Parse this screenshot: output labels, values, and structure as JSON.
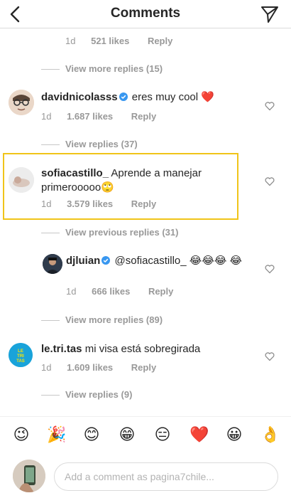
{
  "header": {
    "title": "Comments",
    "back_icon": "chevron-left-icon",
    "send_icon": "paper-plane-icon"
  },
  "top_reply_meta": {
    "time": "1d",
    "likes": "521 likes",
    "reply": "Reply"
  },
  "view_more_1": "View more replies (15)",
  "comments": [
    {
      "username": "davidnicolasss",
      "verified": true,
      "text": "eres muy cool ❤️",
      "time": "1d",
      "likes": "1.687 likes",
      "reply": "Reply",
      "view_replies": "View replies (37)"
    },
    {
      "username": "sofiacastillo_",
      "verified": false,
      "text": "Aprende a manejar primerooooo🙄",
      "time": "1d",
      "likes": "3.579 likes",
      "reply": "Reply",
      "view_previous": "View previous replies (31)"
    }
  ],
  "reply_djluian": {
    "username": "djluian",
    "verified": true,
    "text": "@sofiacastillo_ 😂😂😂 😂",
    "time": "1d",
    "likes": "666 likes",
    "reply": "Reply",
    "view_more": "View more replies (89)"
  },
  "comment_letritas": {
    "username": "le.tri.tas",
    "avatar_text": "LE TRI TAS",
    "text": "mi visa está sobregirada",
    "time": "1d",
    "likes": "1.609 likes",
    "reply": "Reply",
    "view_replies": "View replies (9)"
  },
  "emoji_bar": [
    "😉",
    "🎉",
    "😊",
    "😁",
    "😑",
    "❤️",
    "😀",
    "👌"
  ],
  "compose": {
    "placeholder": "Add a comment as pagina7chile..."
  },
  "colors": {
    "highlight": "#f0c419",
    "muted": "#999999",
    "verified": "#3897f0",
    "heart_red": "#e0201b"
  }
}
